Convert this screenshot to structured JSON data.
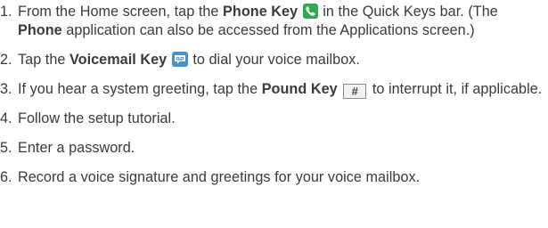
{
  "steps": [
    {
      "num": "1.",
      "p1": "From the Home screen, tap the ",
      "b1": "Phone Key",
      "icon": "phone-icon",
      "p2": " in the Quick Keys bar. (The ",
      "b2": "Phone",
      "p3": " application can also be accessed from the Applications screen.)"
    },
    {
      "num": "2.",
      "p1": "Tap the ",
      "b1": "Voicemail Key",
      "icon": "voicemail-icon",
      "p2": " to dial your voice mailbox."
    },
    {
      "num": "3.",
      "p1": "If you hear a system greeting, tap the ",
      "b1": "Pound Key",
      "key": "#",
      "icon": "pound-key-icon",
      "p2": " to interrupt it, if applicable."
    },
    {
      "num": "4.",
      "text": "Follow the setup tutorial."
    },
    {
      "num": "5.",
      "text": "Enter a password."
    },
    {
      "num": "6.",
      "text": "Record a voice signature and greetings for your voice mailbox."
    }
  ],
  "colors": {
    "text": "#3a3a3a",
    "phone_icon": "#2fa84f",
    "voicemail_icon": "#4a90c8"
  }
}
